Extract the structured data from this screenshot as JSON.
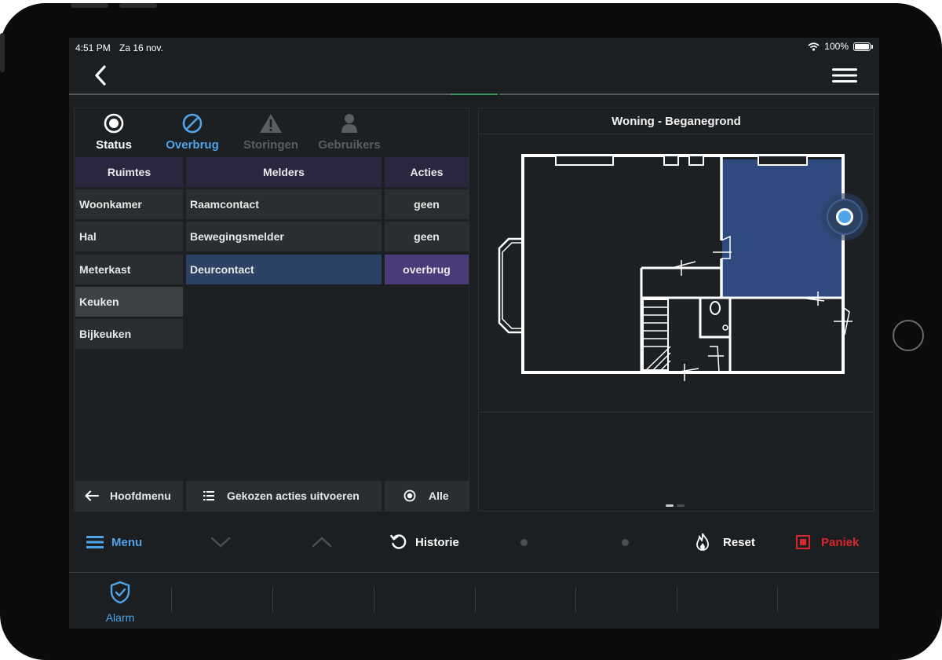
{
  "status_bar": {
    "time": "4:51 PM",
    "date": "Za 16 nov.",
    "battery": "100%"
  },
  "tabs": [
    {
      "label": "Status",
      "icon": "radio-target-icon"
    },
    {
      "label": "Overbrug",
      "icon": "ban-icon"
    },
    {
      "label": "Storingen",
      "icon": "warning-icon"
    },
    {
      "label": "Gebruikers",
      "icon": "user-icon"
    }
  ],
  "table": {
    "headers": {
      "ruimtes": "Ruimtes",
      "melders": "Melders",
      "acties": "Acties"
    },
    "rooms": [
      "Woonkamer",
      "Hal",
      "Meterkast",
      "Keuken",
      "Bijkeuken"
    ],
    "detectors": [
      {
        "name": "Raamcontact",
        "action": "geen"
      },
      {
        "name": "Bewegingsmelder",
        "action": "geen"
      },
      {
        "name": "Deurcontact",
        "action": "overbrug"
      }
    ]
  },
  "footer": {
    "back": "Hoofdmenu",
    "execute": "Gekozen acties uitvoeren",
    "all": "Alle"
  },
  "floorplan": {
    "title": "Woning - Beganegrond",
    "pages": 2,
    "current_page": 1
  },
  "toolbar": {
    "menu": "Menu",
    "historie": "Historie",
    "reset": "Reset",
    "paniek": "Paniek"
  },
  "tabbar": {
    "alarm": "Alarm"
  },
  "colors": {
    "accent_blue": "#4fa3e8",
    "header_purple": "#2b2640",
    "selected_blue": "#2c4264",
    "overbrug_purple": "#4a3a7a",
    "panic_red": "#d9262c",
    "room_highlight": "#2f4a7e"
  }
}
